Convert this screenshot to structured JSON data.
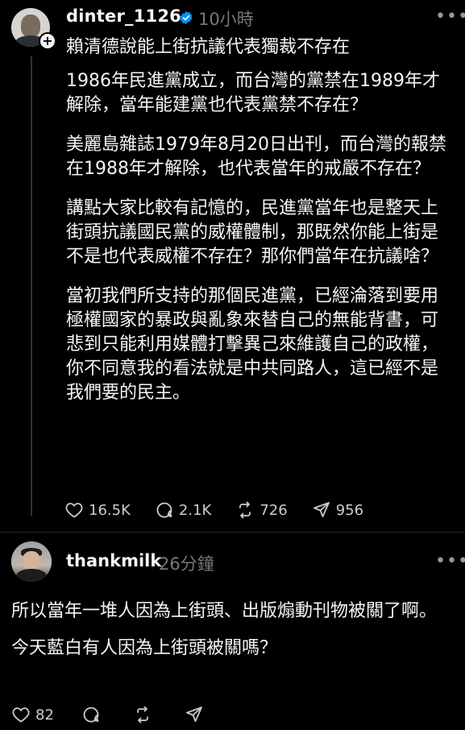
{
  "post": {
    "username": "dinter_1126",
    "time_ago": "10小時",
    "title": "賴清德說能上街抗議代表獨裁不存在",
    "paragraphs": [
      "1986年民進黨成立，而台灣的黨禁在1989年才解除，當年能建黨也代表黨禁不存在？",
      "美麗島雜誌1979年8月20日出刊，而台灣的報禁在1988年才解除，也代表當年的戒嚴不存在？",
      "講點大家比較有記憶的，民進黨當年也是整天上街頭抗議國民黨的威權體制，那既然你能上街是不是也代表威權不存在？那你們當年在抗議啥？",
      "當初我們所支持的那個民進黨，已經淪落到要用極權國家的暴政與亂象來替自己的無能背書，可悲到只能利用媒體打擊異己來維護自己的政權，你不同意我的看法就是中共同路人，這已經不是我們要的民主。"
    ],
    "likes": "16.5K",
    "comments": "2.1K",
    "reposts": "726",
    "shares": "956",
    "more_icon": "more-horizontal-icon"
  },
  "reply": {
    "username": "thankmilk",
    "time_ago": "26分鐘",
    "paragraphs": [
      "所以當年一堆人因為上街頭、出版煽動刊物被關了啊。",
      "今天藍白有人因為上街頭被關嗎？"
    ],
    "likes": "82"
  },
  "colors": {
    "background": "#000000",
    "text": "#f3f5f7",
    "muted": "#777777",
    "verified": "#0095f6"
  }
}
